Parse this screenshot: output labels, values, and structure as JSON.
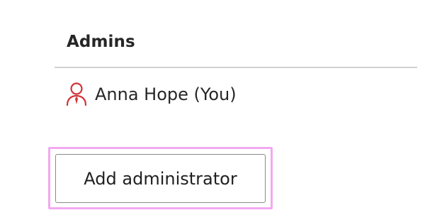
{
  "admins": {
    "header": "Admins",
    "items": [
      {
        "name": "Anna Hope (You)",
        "icon": "admin-user-icon"
      }
    ]
  },
  "actions": {
    "add_admin_label": "Add administrator"
  },
  "colors": {
    "admin_icon": "#d13438",
    "focus_ring": "#f2a8f0",
    "divider": "#d1d1d1"
  }
}
